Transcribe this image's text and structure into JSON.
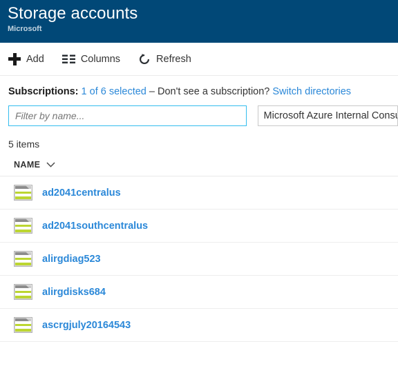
{
  "header": {
    "title": "Storage accounts",
    "subtitle": "Microsoft",
    "background_color": "#014877"
  },
  "toolbar": {
    "add_label": "Add",
    "columns_label": "Columns",
    "refresh_label": "Refresh"
  },
  "subscriptions": {
    "label": "Subscriptions:",
    "selected_link": "1 of 6 selected",
    "middle_text": "– Don't see a subscription?",
    "switch_link": "Switch directories"
  },
  "filters": {
    "name_placeholder": "Filter by name...",
    "name_value": "",
    "subscription_value": "Microsoft Azure Internal Consumption",
    "focus_border_color": "#32bcee"
  },
  "list": {
    "count_text": "5 items",
    "column_header": "NAME",
    "link_color": "#2b88d8",
    "rows": [
      {
        "name": "ad2041centralus"
      },
      {
        "name": "ad2041southcentralus"
      },
      {
        "name": "alirgdiag523"
      },
      {
        "name": "alirgdisks684"
      },
      {
        "name": "ascrgjuly20164543"
      }
    ]
  }
}
